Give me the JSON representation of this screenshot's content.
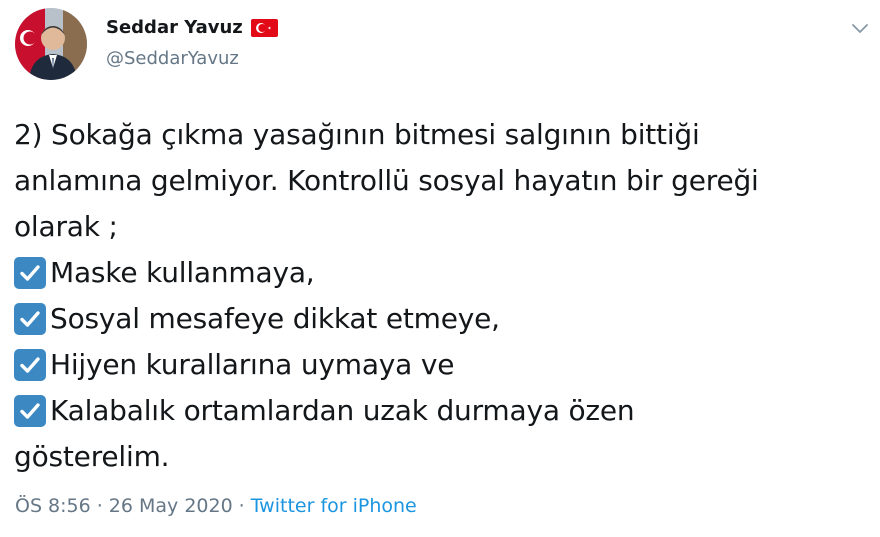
{
  "user": {
    "display_name": "Seddar Yavuz",
    "handle": "@SeddarYavuz",
    "flag_icon": "turkey-flag-icon",
    "avatar_icon": "profile-photo"
  },
  "tweet": {
    "lines": [
      {
        "check": false,
        "text": "2) Sokağa çıkma yasağının bitmesi salgının bittiği"
      },
      {
        "check": false,
        "text": "anlamına gelmiyor. Kontrollü sosyal hayatın bir gereği"
      },
      {
        "check": false,
        "text": "olarak ;"
      },
      {
        "check": true,
        "text": "Maske kullanmaya,"
      },
      {
        "check": true,
        "text": "Sosyal mesafeye dikkat etmeye,"
      },
      {
        "check": true,
        "text": "Hijyen kurallarına uymaya ve"
      },
      {
        "check": true,
        "text": "Kalabalık ortamlardan uzak durmaya özen"
      },
      {
        "check": false,
        "text": "gösterelim."
      }
    ],
    "check_icon": "check-mark-button-icon"
  },
  "meta": {
    "time": "ÖS 8:56",
    "separator": "·",
    "date": "26 May 2020",
    "source": "Twitter for iPhone"
  },
  "colors": {
    "text": "#14171a",
    "secondary": "#657786",
    "link": "#1b95e0",
    "check_bg": "#3b88c3",
    "flag_red": "#e30a17"
  }
}
